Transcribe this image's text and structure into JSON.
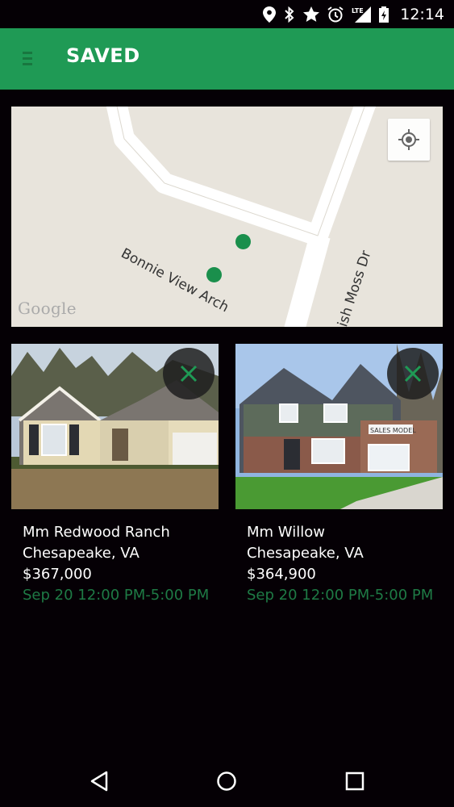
{
  "status_bar": {
    "time": "12:14",
    "icons": [
      "location-icon",
      "bluetooth-icon",
      "star-icon",
      "alarm-icon",
      "lte-signal-icon",
      "battery-charging-icon"
    ]
  },
  "app_bar": {
    "title": "SAVED",
    "menu_icon": "menu-icon",
    "color": "#1f9a55"
  },
  "map": {
    "streets": [
      "Bonnie View Arch",
      "Spanish Moss Dr"
    ],
    "attribution": "Google",
    "locate_icon": "my-location-icon",
    "pin_color": "#1a8f4c"
  },
  "listings": [
    {
      "name": "Mm Redwood Ranch",
      "location": "Chesapeake, VA",
      "price": "$367,000",
      "open_house": "Sep 20 12:00 PM-5:00 PM",
      "remove_icon": "close-icon"
    },
    {
      "name": "Mm Willow",
      "location": "Chesapeake, VA",
      "price": "$364,900",
      "open_house": "Sep 20 12:00 PM-5:00 PM",
      "remove_icon": "close-icon",
      "photo_sign": "SALES MODEL"
    }
  ],
  "nav_bar": {
    "icons": [
      "back-icon",
      "home-icon",
      "recents-icon"
    ]
  },
  "colors": {
    "accent_green": "#1f9a55",
    "open_house_text": "#1e7a45",
    "background": "#050005"
  }
}
